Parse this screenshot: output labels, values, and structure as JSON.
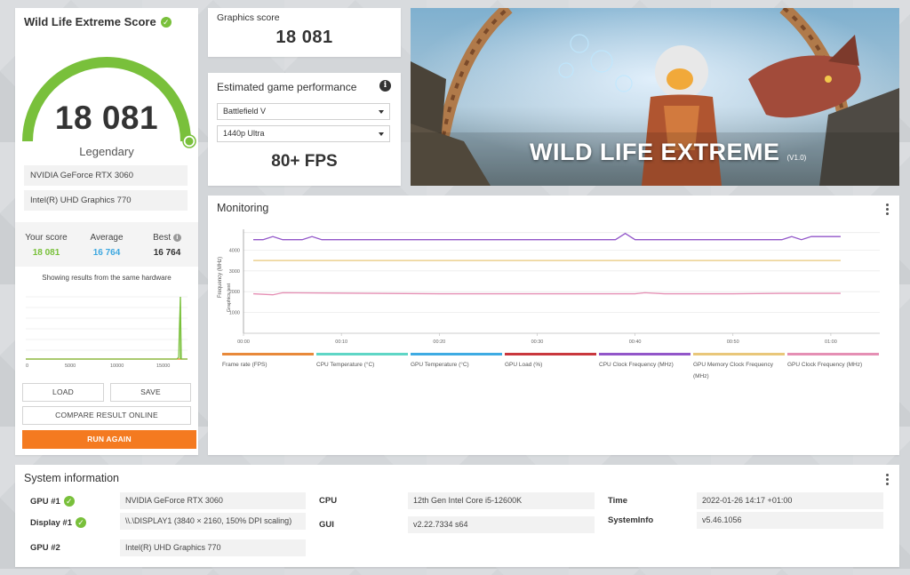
{
  "score_card": {
    "title": "Wild Life Extreme Score",
    "score": "18 081",
    "rank": "Legendary",
    "hardware": [
      "NVIDIA GeForce RTX 3060",
      "Intel(R) UHD Graphics 770"
    ],
    "your_score_label": "Your score",
    "your_score": "18 081",
    "average_label": "Average",
    "average": "16 764",
    "best_label": "Best",
    "best": "16 764",
    "showing_text": "Showing results from the same hardware",
    "dist_ticks": [
      "0",
      "5000",
      "10000",
      "15000"
    ],
    "load_label": "LOAD",
    "save_label": "SAVE",
    "compare_label": "COMPARE RESULT ONLINE",
    "run_label": "RUN AGAIN"
  },
  "graphics": {
    "label": "Graphics score",
    "value": "18 081"
  },
  "estimate": {
    "title": "Estimated game performance",
    "game": "Battlefield V",
    "preset": "1440p Ultra",
    "fps": "80+ FPS"
  },
  "banner": {
    "title": "WILD LIFE EXTREME",
    "version": "(V1.0)"
  },
  "monitoring": {
    "title": "Monitoring",
    "y_axis_label": "Frequency (MHz)",
    "y_axis_sub": "Graphics test",
    "y_ticks": [
      "1000",
      "2000",
      "3000",
      "4000"
    ],
    "x_ticks": [
      "00:00",
      "00:10",
      "00:20",
      "00:30",
      "00:40",
      "00:50",
      "01:00"
    ],
    "legend": [
      {
        "label": "Frame rate (FPS)",
        "color": "#e8893a"
      },
      {
        "label": "CPU Temperature (°C)",
        "color": "#5fd6c6"
      },
      {
        "label": "GPU Temperature (°C)",
        "color": "#3eabe3"
      },
      {
        "label": "GPU Load (%)",
        "color": "#c9373d"
      },
      {
        "label": "CPU Clock Frequency (MHz)",
        "color": "#9256c9"
      },
      {
        "label": "GPU Memory Clock Frequency (MHz)",
        "color": "#e9c77a"
      },
      {
        "label": "GPU Clock Frequency (MHz)",
        "color": "#e58fb4"
      }
    ]
  },
  "chart_data": {
    "type": "line",
    "x_unit": "seconds",
    "ylim": [
      0,
      5000
    ],
    "xlim": [
      0,
      65
    ],
    "series": [
      {
        "name": "CPU Clock Frequency (MHz)",
        "color": "#9256c9",
        "x": [
          1,
          2,
          3,
          4,
          5,
          6,
          7,
          8,
          9,
          20,
          30,
          38,
          39,
          40,
          41,
          48,
          55,
          56,
          57,
          58,
          59,
          60,
          61
        ],
        "y": [
          4500,
          4500,
          4650,
          4500,
          4500,
          4500,
          4650,
          4500,
          4500,
          4500,
          4500,
          4500,
          4800,
          4500,
          4500,
          4500,
          4500,
          4650,
          4500,
          4650,
          4650,
          4650,
          4650
        ]
      },
      {
        "name": "GPU Memory Clock Frequency (MHz)",
        "color": "#e9c77a",
        "x": [
          1,
          61
        ],
        "y": [
          3500,
          3500
        ]
      },
      {
        "name": "GPU Clock Frequency (MHz)",
        "color": "#e58fb4",
        "x": [
          1,
          3,
          4,
          20,
          30,
          40,
          41,
          43,
          50,
          55,
          61
        ],
        "y": [
          1900,
          1850,
          1950,
          1900,
          1900,
          1900,
          1950,
          1900,
          1900,
          1920,
          1920
        ]
      }
    ]
  },
  "system": {
    "title": "System information",
    "rows": [
      {
        "label": "GPU #1",
        "value": "NVIDIA GeForce RTX 3060",
        "check": true
      },
      {
        "label": "Display #1",
        "value": "\\\\.\\DISPLAY1 (3840 × 2160, 150% DPI scaling)",
        "check": true
      },
      {
        "label": "GPU #2",
        "value": "Intel(R) UHD Graphics 770",
        "check": false
      },
      {
        "label": "CPU",
        "value": "12th Gen Intel Core i5-12600K"
      },
      {
        "label": "GUI",
        "value": "v2.22.7334 s64"
      },
      {
        "label": "Time",
        "value": "2022-01-26 14:17 +01:00"
      },
      {
        "label": "SystemInfo",
        "value": "v5.46.1056"
      }
    ]
  },
  "colors": {
    "accent_green": "#79c03b",
    "accent_orange": "#f47a20",
    "score_green": "#79c03b",
    "average_blue": "#3ea8e0"
  }
}
